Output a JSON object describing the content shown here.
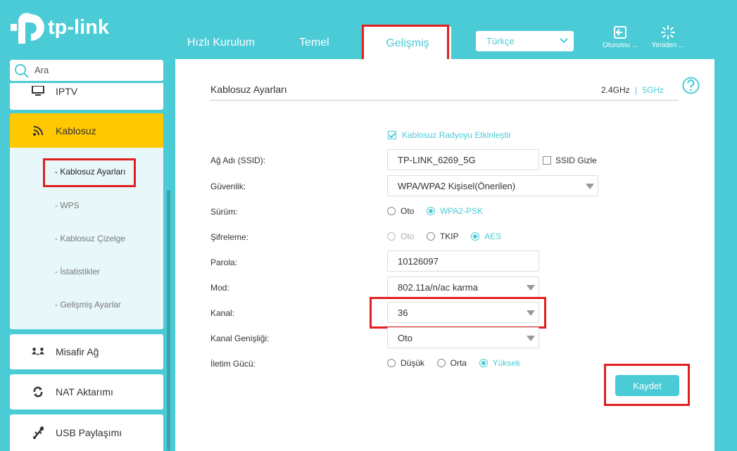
{
  "brand": {
    "name": "tp-link"
  },
  "nav": {
    "tabs": [
      "Hızlı Kurulum",
      "Temel",
      "Gelişmiş"
    ],
    "active_tab": "Gelişmiş",
    "language": "Türkçe",
    "logout_label": "Oturumu ...",
    "reboot_label": "Yeniden ..."
  },
  "sidebar": {
    "search_placeholder": "Ara",
    "items": [
      {
        "label": "IPTV",
        "icon": "tv-icon"
      },
      {
        "label": "Kablosuz",
        "icon": "wifi-icon",
        "active": true
      },
      {
        "label": "Misafir Ağ",
        "icon": "guest-icon"
      },
      {
        "label": "NAT Aktarımı",
        "icon": "nat-icon"
      },
      {
        "label": "USB Paylaşımı",
        "icon": "usb-icon"
      }
    ],
    "subitems": [
      "- Kablosuz Ayarları",
      "- WPS",
      "- Kablosuz Çizelge",
      "- İstatistikler",
      "- Gelişmiş Ayarlar"
    ],
    "active_subitem": "- Kablosuz Ayarları"
  },
  "main": {
    "title": "Kablosuz Ayarları",
    "band_24": "2.4GHz",
    "band_sep": "|",
    "band_5": "5GHz",
    "enable_radio_label": "Kablosuz Radyoyu Etkinleştir",
    "ssid_label": "Ağ Adı (SSID):",
    "ssid_value": "TP-LINK_6269_5G",
    "ssid_hide_label": "SSID Gizle",
    "security_label": "Güvenlik:",
    "security_value": "WPA/WPA2 Kişisel(Önerilen)",
    "version_label": "Sürüm:",
    "version_options": [
      "Oto",
      "WPA2-PSK"
    ],
    "version_selected": "WPA2-PSK",
    "encryption_label": "Şifreleme:",
    "encryption_options": [
      "Oto",
      "TKIP",
      "AES"
    ],
    "encryption_selected": "AES",
    "password_label": "Parola:",
    "password_value": "10126097",
    "mode_label": "Mod:",
    "mode_value": "802.11a/n/ac karma",
    "channel_label": "Kanal:",
    "channel_value": "36",
    "channel_width_label": "Kanal Genişliği:",
    "channel_width_value": "Oto",
    "tx_power_label": "İletim Gücü:",
    "tx_power_options": [
      "Düşük",
      "Orta",
      "Yüksek"
    ],
    "tx_power_selected": "Yüksek",
    "save_label": "Kaydet"
  },
  "colors": {
    "accent": "#4acbd6",
    "highlight": "#e02020",
    "active_sidebar": "#ffc800"
  }
}
